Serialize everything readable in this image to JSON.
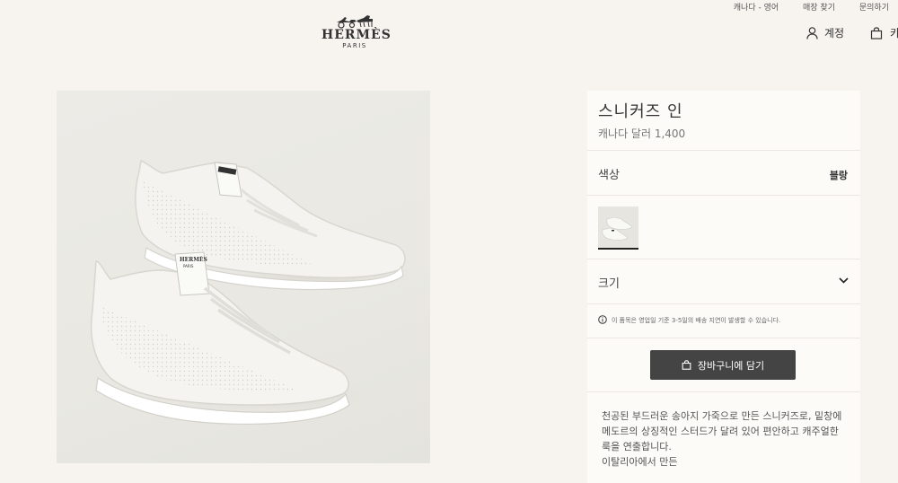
{
  "top_links": [
    "캐나다 - 영어",
    "매장 찾기",
    "문의하기"
  ],
  "logo": {
    "name": "HERMÈS",
    "city": "PARIS"
  },
  "account": {
    "icon": "user-icon",
    "label": "계정"
  },
  "cart": {
    "icon": "bag-icon",
    "label": "카트"
  },
  "product": {
    "title": "스니커즈 인",
    "price": "캐나다 달러 1,400",
    "color_label": "색상",
    "color_value": "블랑",
    "size_label": "크기",
    "notice": "이 품목은 영업일 기준 3-5일의 배송 지연이 발생할 수 있습니다.",
    "add_to_cart": "장바구니에 담기",
    "description": "천공된 부드러운 송아지 가죽으로 만든 스니커즈로, 밑창에 메도르의 상징적인 스터드가 달려 있어 편안하고 캐주얼한 룩을 연출합니다.",
    "origin": "이탈리아에서 만든",
    "shoe_brand": "HERMÈS",
    "shoe_city": "PARIS"
  },
  "colors": {
    "background": "#f7f3ef",
    "panel": "#fdfbf8",
    "button": "#444444"
  }
}
